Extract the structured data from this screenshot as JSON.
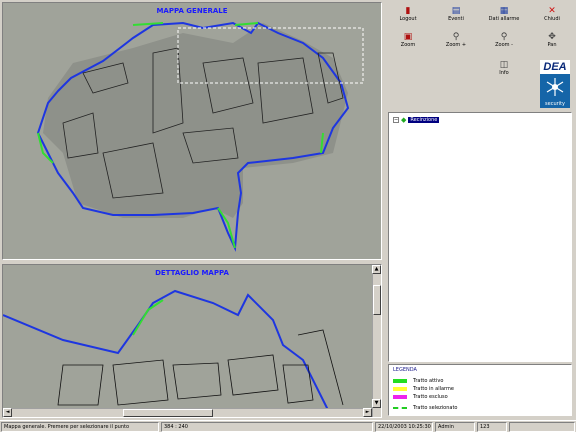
{
  "overview_map": {
    "title": "MAPPA GENERALE"
  },
  "detail_map": {
    "title": "DETTAGLIO MAPPA"
  },
  "toolbar": {
    "items": [
      {
        "label": "Logout",
        "icon": "logout-icon",
        "color": "#b01010"
      },
      {
        "label": "Eventi",
        "icon": "events-icon",
        "color": "#1a3aa0"
      },
      {
        "label": "Dati allarme",
        "icon": "alarm-data-icon",
        "color": "#1a3aa0"
      },
      {
        "label": "Chiudi",
        "icon": "close-icon",
        "color": "#d01010"
      },
      {
        "label": "Zoom",
        "icon": "zoom-icon",
        "color": "#b01010"
      },
      {
        "label": "Zoom +",
        "icon": "zoom-in-icon",
        "color": "#404040"
      },
      {
        "label": "Zoom -",
        "icon": "zoom-out-icon",
        "color": "#404040"
      },
      {
        "label": "Pan",
        "icon": "pan-icon",
        "color": "#404040"
      },
      {
        "label": "Info",
        "icon": "info-icon",
        "color": "#404040"
      }
    ]
  },
  "logo": {
    "brand": "DEA",
    "subtitle": "security"
  },
  "tree": {
    "root_label": "Recinzione"
  },
  "legend": {
    "title": "LEGENDA",
    "items": [
      {
        "label": "Tratto attivo",
        "color": "#22dd22"
      },
      {
        "label": "Tratto in allarme",
        "color": "#ffff33"
      },
      {
        "label": "Tratto escluso",
        "color": "#ee22ee"
      },
      {
        "label": "Tratto selezionato",
        "color": "#22cc22"
      }
    ]
  },
  "statusbar": {
    "message": "Mappa generale. Premere per selezionare il punto",
    "coords": "384 : 240",
    "datetime": "22/10/2003 10:25:30",
    "user": "Admin",
    "count": "123"
  }
}
